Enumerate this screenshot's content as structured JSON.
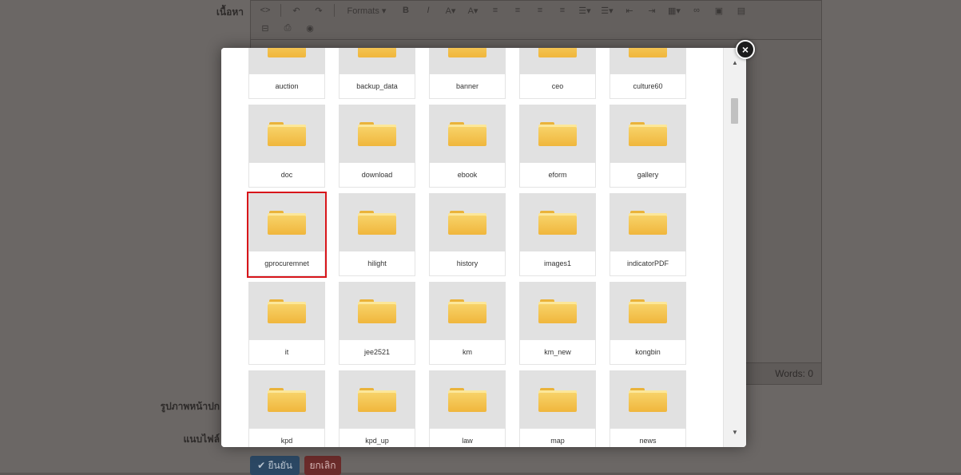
{
  "background": {
    "label_content": "เนื้อหา",
    "label_cover_image": "รูปภาพหน้าปก",
    "label_attach": "แนบไฟล์",
    "toolbar": {
      "formats_label": "Formats ▾",
      "bold": "B",
      "italic": "I"
    },
    "word_count": "Words: 0",
    "confirm_button": "✔ ยืนยัน",
    "cancel_button": "ยกเลิก"
  },
  "file_browser": {
    "rows": [
      [
        "auction",
        "backup_data",
        "banner",
        "ceo",
        "culture60"
      ],
      [
        "doc",
        "download",
        "ebook",
        "eform",
        "gallery"
      ],
      [
        "gprocuremnet",
        "hilight",
        "history",
        "images1",
        "indicatorPDF"
      ],
      [
        "it",
        "jee2521",
        "km",
        "km_new",
        "kongbin"
      ],
      [
        "kpd",
        "kpd_up",
        "law",
        "map",
        "news"
      ]
    ],
    "selected_folder": "gprocuremnet",
    "close_label": "×"
  },
  "colors": {
    "selection_border": "#d8151a",
    "folder_yellow": "#f0b63c"
  }
}
